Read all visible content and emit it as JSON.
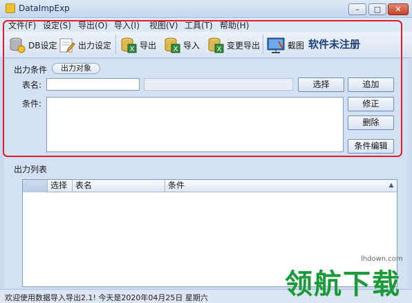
{
  "window": {
    "title": "DataImpExp",
    "minimize": "–",
    "maximize": "□",
    "close": "✕"
  },
  "menu": [
    "文件(F)",
    "设定(S)",
    "导出(O)",
    "导入(I)",
    "视图(V)",
    "工具(T)",
    "帮助(H)"
  ],
  "toolbar": {
    "db_setting": "DB设定",
    "output_setting": "出力设定",
    "export": "导出",
    "import": "导入",
    "change_export": "变更导出",
    "screenshot": "截图",
    "unregistered": "软件未注册"
  },
  "output_condition": {
    "group_label": "出力条件",
    "tab_label": "出力对象",
    "table_label": "表名:",
    "table_value": "",
    "condition_label": "条件:",
    "condition_value": "",
    "select_button": "选择",
    "add_button": "追加",
    "modify_button": "修正",
    "delete_button": "删除",
    "edit_condition_button": "条件编辑"
  },
  "output_list": {
    "group_label": "出力列表",
    "columns": [
      "选择",
      "表名",
      "条件"
    ]
  },
  "status": {
    "text": "欢迎使用数据导入导出2.1! 今天是2020年04月25日  星期六"
  },
  "watermark": {
    "brand": "领航下载",
    "url": "lhdown.com"
  },
  "colors": {
    "highlight": "#e01a2b",
    "watermark": "#1a9b38"
  }
}
